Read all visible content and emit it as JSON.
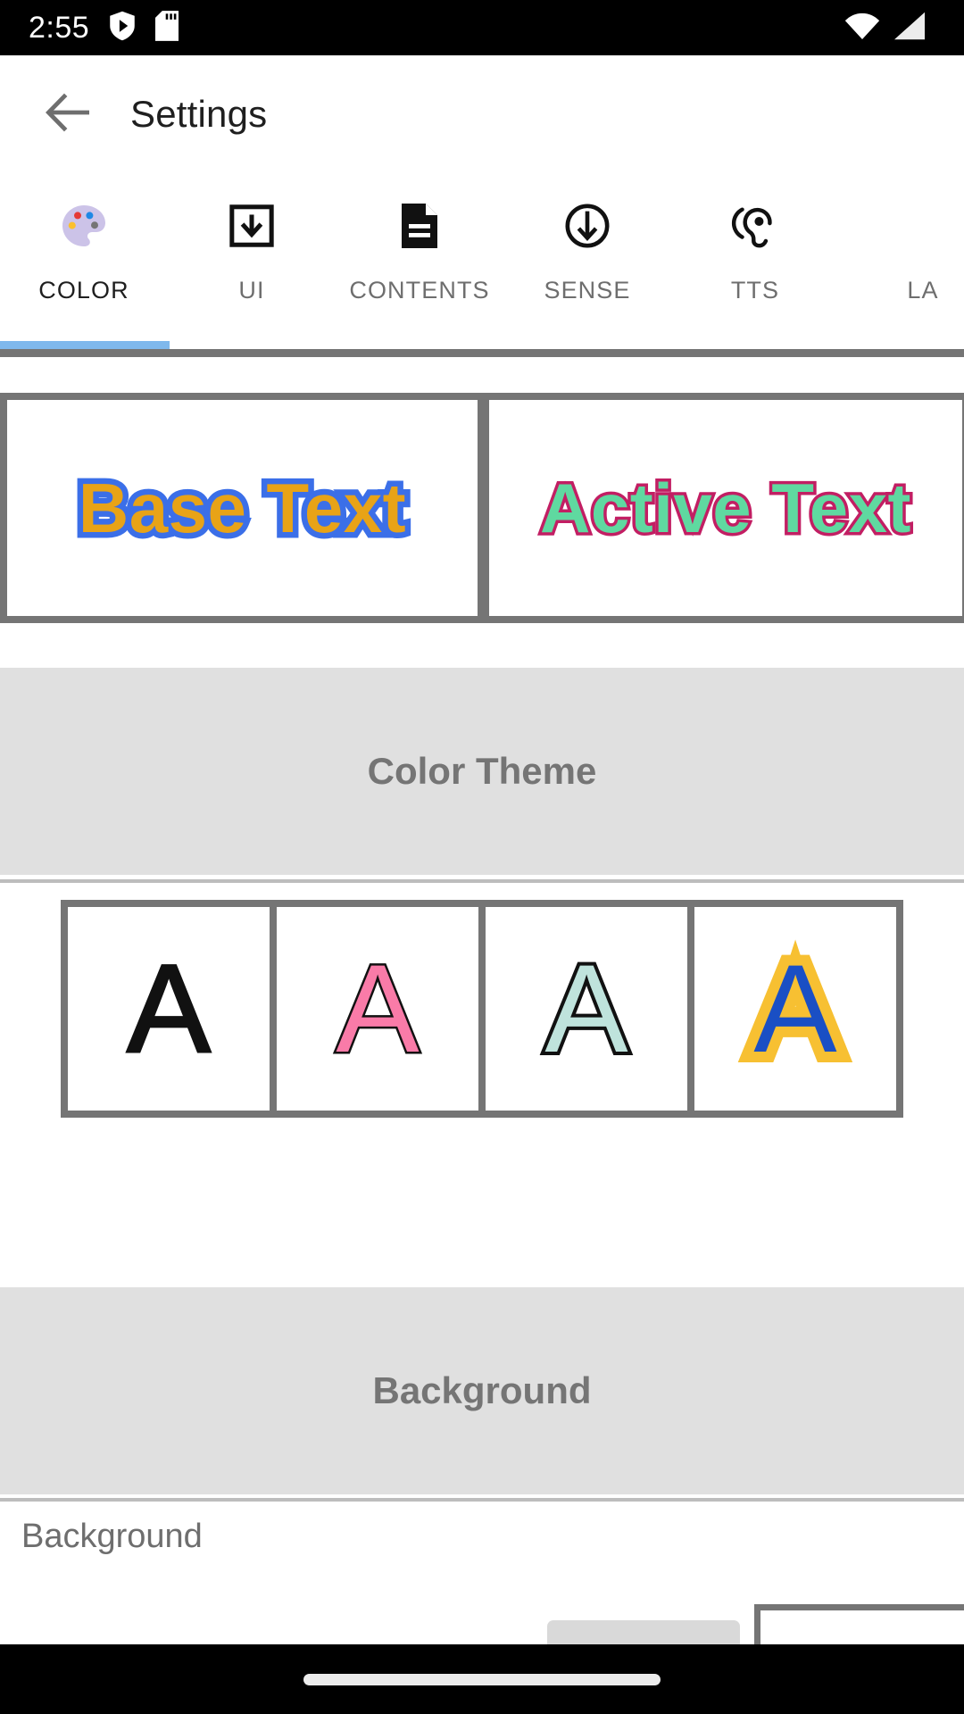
{
  "status_bar": {
    "clock": "2:55",
    "icons_left": [
      "shield-play-icon",
      "sd-card-icon"
    ],
    "icons_right": [
      "wifi-icon",
      "cell-signal-icon"
    ]
  },
  "app_bar": {
    "back_icon": "back-arrow-icon",
    "title": "Settings"
  },
  "tabs": {
    "selected_index": 0,
    "indicator_color": "#7fb8ec",
    "items": [
      {
        "label": "COLOR",
        "icon": "palette-icon",
        "selected": true
      },
      {
        "label": "UI",
        "icon": "download-box-icon",
        "selected": false
      },
      {
        "label": "CONTENTS",
        "icon": "document-icon",
        "selected": false
      },
      {
        "label": "SENSE",
        "icon": "circle-arrow-down-icon",
        "selected": false
      },
      {
        "label": "TTS",
        "icon": "hearing-ear-icon",
        "selected": false
      },
      {
        "label": "LA",
        "icon": "language-icon",
        "selected": false
      }
    ]
  },
  "preview": {
    "base": {
      "text": "Base Text",
      "fill_color": "#e8a317",
      "outline_color": "#3b6fe8"
    },
    "active": {
      "text": "Active Text",
      "fill_color": "#5fd9a0",
      "outline_color": "#c21e63"
    }
  },
  "sections": {
    "color_theme": {
      "title": "Color Theme",
      "swatches": [
        {
          "letter": "A",
          "fill_color": "#111111",
          "outline_color": "#111111",
          "name": "theme-black"
        },
        {
          "letter": "A",
          "fill_color": "#f97ba8",
          "outline_color": "#111111",
          "name": "theme-pink"
        },
        {
          "letter": "A",
          "fill_color": "#bfe3dc",
          "outline_color": "#111111",
          "name": "theme-mint"
        },
        {
          "letter": "A",
          "fill_color": "#1a4fc4",
          "outline_color": "#f7c032",
          "name": "theme-amber-blue"
        }
      ]
    },
    "background": {
      "title": "Background",
      "row_label": "Background"
    }
  },
  "nav_bar": {
    "home_indicator": "home-pill"
  }
}
